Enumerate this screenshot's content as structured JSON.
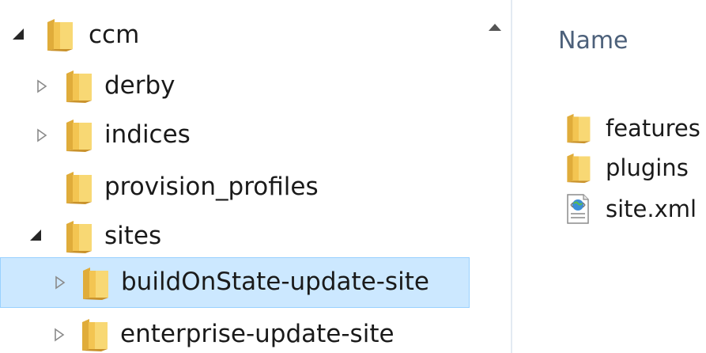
{
  "navigation_pane": {
    "items": [
      {
        "label": "ccm",
        "expanded": true,
        "has_children": true,
        "selected": false,
        "depth": 0
      },
      {
        "label": "derby",
        "expanded": false,
        "has_children": true,
        "selected": false,
        "depth": 1
      },
      {
        "label": "indices",
        "expanded": false,
        "has_children": true,
        "selected": false,
        "depth": 1
      },
      {
        "label": "provision_profiles",
        "expanded": false,
        "has_children": false,
        "selected": false,
        "depth": 1
      },
      {
        "label": "sites",
        "expanded": true,
        "has_children": true,
        "selected": false,
        "depth": 1
      },
      {
        "label": "buildOnState-update-site",
        "expanded": false,
        "has_children": true,
        "selected": true,
        "depth": 2
      },
      {
        "label": "enterprise-update-site",
        "expanded": false,
        "has_children": true,
        "selected": false,
        "depth": 2
      }
    ]
  },
  "content_pane": {
    "column_header": "Name",
    "files": [
      {
        "name": "features",
        "icon": "folder-icon"
      },
      {
        "name": "plugins",
        "icon": "folder-icon"
      },
      {
        "name": "site.xml",
        "icon": "xml-document-icon"
      }
    ]
  },
  "colors": {
    "selection_background": "#cce8ff",
    "selection_border": "#99d1ff",
    "folder_yellow": "#f4d26b",
    "column_header_text": "#4c607a"
  }
}
